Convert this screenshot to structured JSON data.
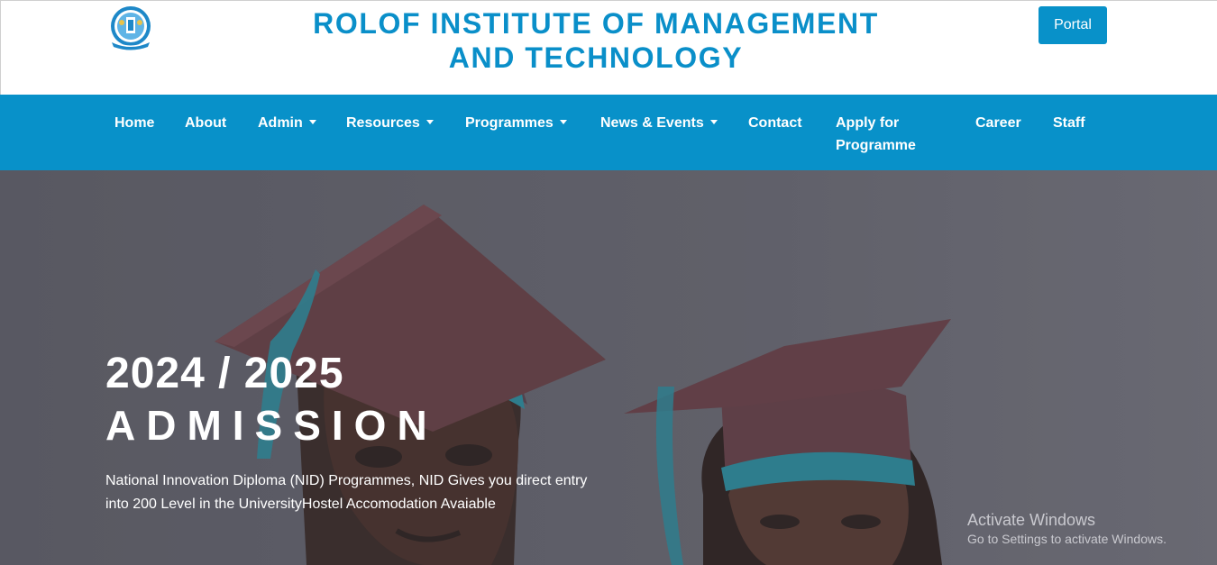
{
  "header": {
    "title_line1": "ROLOF INSTITUTE OF MANAGEMENT",
    "title_line2": "AND TECHNOLOGY",
    "logo_icon": "institute-crest-logo",
    "portal_label": "Portal"
  },
  "nav": {
    "items": [
      {
        "label": "Home",
        "dropdown": false
      },
      {
        "label": "About",
        "dropdown": false
      },
      {
        "label": "Admin",
        "dropdown": true
      },
      {
        "label": "Resources",
        "dropdown": true
      },
      {
        "label": "Programmes",
        "dropdown": true
      },
      {
        "label": "News & Events",
        "dropdown": true
      },
      {
        "label": "Contact",
        "dropdown": false
      },
      {
        "label": "Apply for",
        "label_line2": "Programme",
        "dropdown": false
      },
      {
        "label": "Career",
        "dropdown": false
      },
      {
        "label": "Staff",
        "dropdown": false
      }
    ]
  },
  "hero": {
    "year": "2024 / 2025",
    "headline": "ADMISSION",
    "description_line1": "National Innovation Diploma (NID) Programmes, NID Gives you direct entry",
    "description_line2": "into 200 Level in the UniversityHostel Accomodation Avaiable"
  },
  "watermark": {
    "title": "Activate Windows",
    "subtitle": "Go to Settings to activate Windows."
  },
  "colors": {
    "brand_blue": "#0891c9",
    "title_blue": "#0a8fc9",
    "hero_background": "#6a6a74"
  }
}
